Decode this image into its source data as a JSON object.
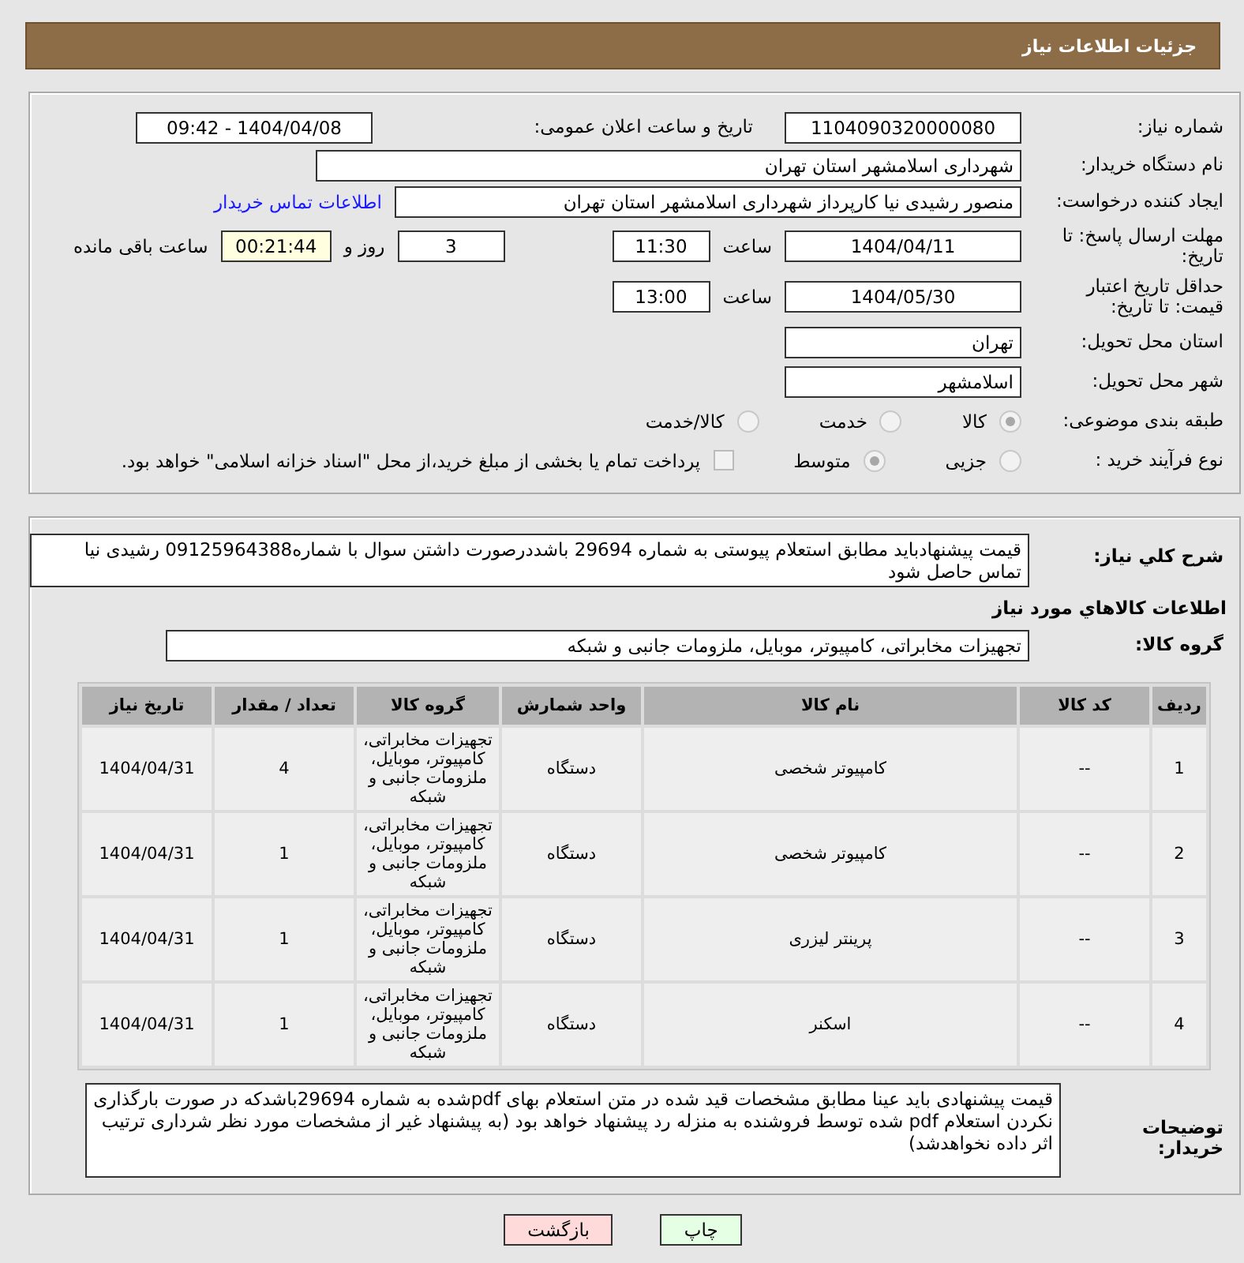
{
  "header": {
    "title": "جزئیات اطلاعات نیاز"
  },
  "need_number": {
    "label": "شماره نیاز:",
    "value": "1104090320000080"
  },
  "announce": {
    "label": "تاریخ و ساعت اعلان عمومی:",
    "value": "1404/04/08 - 09:42"
  },
  "buyer_org": {
    "label": "نام دستگاه خریدار:",
    "value": "شهرداری اسلامشهر استان تهران"
  },
  "requester": {
    "label": "ایجاد کننده درخواست:",
    "value": "منصور رشیدی نیا کارپرداز شهرداری اسلامشهر استان تهران",
    "link": "اطلاعات تماس خریدار"
  },
  "reply_deadline": {
    "label": "مهلت ارسال پاسخ: تا تاریخ:",
    "date": "1404/04/11",
    "time_label": "ساعت",
    "time": "11:30",
    "days": "3",
    "days_label": "روز و",
    "remaining": "00:21:44",
    "remaining_label": "ساعت باقی مانده"
  },
  "price_validity": {
    "label": "حداقل تاریخ اعتبار قیمت: تا تاریخ:",
    "date": "1404/05/30",
    "time_label": "ساعت",
    "time": "13:00"
  },
  "province": {
    "label": "استان محل تحویل:",
    "value": "تهران"
  },
  "city": {
    "label": "شهر محل تحویل:",
    "value": "اسلامشهر"
  },
  "category": {
    "label": "طبقه بندی موضوعی:",
    "options": [
      {
        "label": "کالا",
        "selected": true
      },
      {
        "label": "خدمت",
        "selected": false
      },
      {
        "label": "کالا/خدمت",
        "selected": false
      }
    ]
  },
  "process": {
    "label": "نوع فرآیند خرید :",
    "options": [
      {
        "label": "جزیی",
        "selected": false
      },
      {
        "label": "متوسط",
        "selected": true
      }
    ],
    "payment": {
      "label": "پرداخت تمام یا بخشی از مبلغ خرید،از محل \"اسناد خزانه اسلامی\" خواهد بود.",
      "checked": false
    }
  },
  "summary": {
    "label": "شرح کلي نياز:",
    "value": "قیمت پیشنهادباید مطابق استعلام پیوستی به شماره 29694 باشددرصورت داشتن سوال با شماره09125964388 رشیدی نیا تماس حاصل شود"
  },
  "goods_heading": "اطلاعات کالاهاي مورد نياز",
  "goods_group": {
    "label": "گروه کالا:",
    "value": "تجهیزات مخابراتی، کامپیوتر، موبایل، ملزومات جانبی و شبکه"
  },
  "table": {
    "columns": [
      "ردیف",
      "کد کالا",
      "نام کالا",
      "واحد شمارش",
      "گروه کالا",
      "تعداد / مقدار",
      "تاریخ نیاز"
    ],
    "rows": [
      [
        "1",
        "--",
        "کامپیوتر شخصی",
        "دستگاه",
        "تجهیزات مخابراتی، کامپیوتر، موبایل، ملزومات جانبی و شبکه",
        "4",
        "1404/04/31"
      ],
      [
        "2",
        "--",
        "کامپیوتر شخصی",
        "دستگاه",
        "تجهیزات مخابراتی، کامپیوتر، موبایل، ملزومات جانبی و شبکه",
        "1",
        "1404/04/31"
      ],
      [
        "3",
        "--",
        "پرینتر لیزری",
        "دستگاه",
        "تجهیزات مخابراتی، کامپیوتر، موبایل، ملزومات جانبی و شبکه",
        "1",
        "1404/04/31"
      ],
      [
        "4",
        "--",
        "اسکنر",
        "دستگاه",
        "تجهیزات مخابراتی، کامپیوتر، موبایل، ملزومات جانبی و شبکه",
        "1",
        "1404/04/31"
      ]
    ]
  },
  "buyer_notes": {
    "label": "توضیحات خریدار:",
    "value": "قیمت پیشنهادی باید عینا مطابق مشخصات قید شده در متن استعلام بهای pdfشده به شماره 29694باشدکه  در صورت بارگذاری نکردن استعلام pdf شده توسط فروشنده به منزله رد پیشنهاد خواهد بود (به پیشنهاد غیر از مشخصات مورد نظر شرداری ترتیب اثر داده نخواهدشد)"
  },
  "buttons": [
    {
      "label": "چاپ",
      "kind": "print"
    },
    {
      "label": "بازگشت",
      "kind": "back"
    }
  ]
}
